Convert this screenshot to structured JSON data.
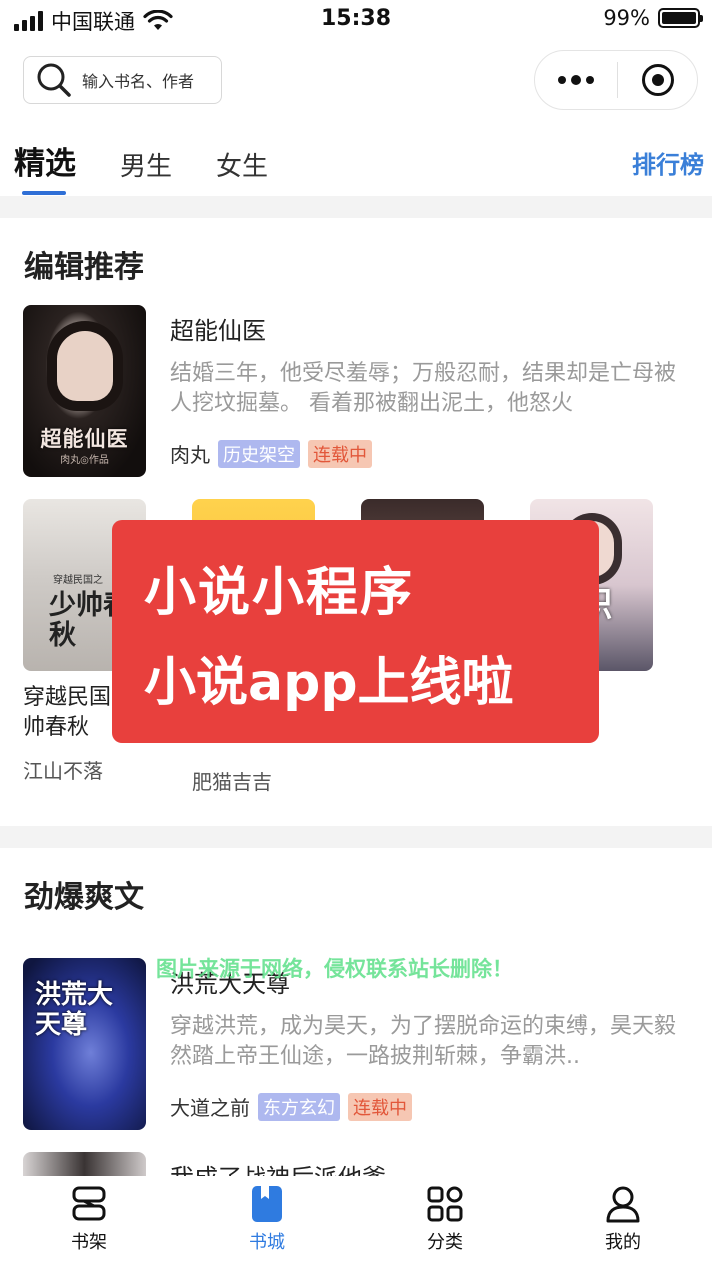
{
  "status_bar": {
    "carrier": "中国联通",
    "time": "15:38",
    "battery": "99%",
    "battery_level": 0.99
  },
  "search": {
    "placeholder": "输入书名、作者",
    "icon": "search-icon"
  },
  "capsule": {
    "more_icon": "more-dots-icon",
    "close_icon": "target-close-icon"
  },
  "tabs": [
    {
      "label": "精选",
      "active": true
    },
    {
      "label": "男生",
      "active": false
    },
    {
      "label": "女生",
      "active": false
    }
  ],
  "rank_link": "排行榜",
  "sections": {
    "editor": {
      "title": "编辑推荐",
      "featured": {
        "title": "超能仙医",
        "desc": "结婚三年，他受尽羞辱；万般忍耐，结果却是亡母被人挖坟掘墓。 看着那被翻出泥土，他怒火",
        "author": "肉丸",
        "genre": "历史架空",
        "status": "连载中",
        "cover_text": "超能仙医",
        "cover_sub": "肉丸◎作品"
      },
      "grid": [
        {
          "title": "穿越民国：少帅春秋",
          "author": "江山不落",
          "cover_text": "少帅春秋",
          "cover_top": "穿越民国之"
        },
        {
          "title": "",
          "author": "肥猫吉吉",
          "cover_text": ""
        },
        {
          "title": "",
          "author": "",
          "cover_text": ""
        },
        {
          "title": "",
          "author": "",
          "cover_text": "全职"
        }
      ]
    },
    "hot": {
      "title": "劲爆爽文",
      "featured": {
        "title": "洪荒大天尊",
        "desc": "穿越洪荒，成为昊天，为了摆脱命运的束缚，昊天毅然踏上帝王仙途，一路披荆斩棘，争霸洪..",
        "author": "大道之前",
        "genre": "东方玄幻",
        "status": "连载中",
        "cover_text": "洪荒大天尊"
      },
      "next_title": "我成了战神后派他爹"
    }
  },
  "promo": {
    "line1": "小说小程序",
    "line2": "小说app上线啦"
  },
  "watermark": "图片来源于网络，侵权联系站长删除！",
  "bottom_nav": [
    {
      "label": "书架",
      "icon": "bookshelf-icon",
      "active": false
    },
    {
      "label": "书城",
      "icon": "bookstore-icon",
      "active": true
    },
    {
      "label": "分类",
      "icon": "category-grid-icon",
      "active": false
    },
    {
      "label": "我的",
      "icon": "user-icon",
      "active": false
    }
  ],
  "colors": {
    "accent": "#2f7be0",
    "rank": "#3a7fd8",
    "promo_bg": "#e8403d",
    "tag_genre": "#aeb8ef",
    "tag_status_bg": "#f6c7b3",
    "tag_status_text": "#e2573a",
    "watermark": "#5ee089"
  }
}
